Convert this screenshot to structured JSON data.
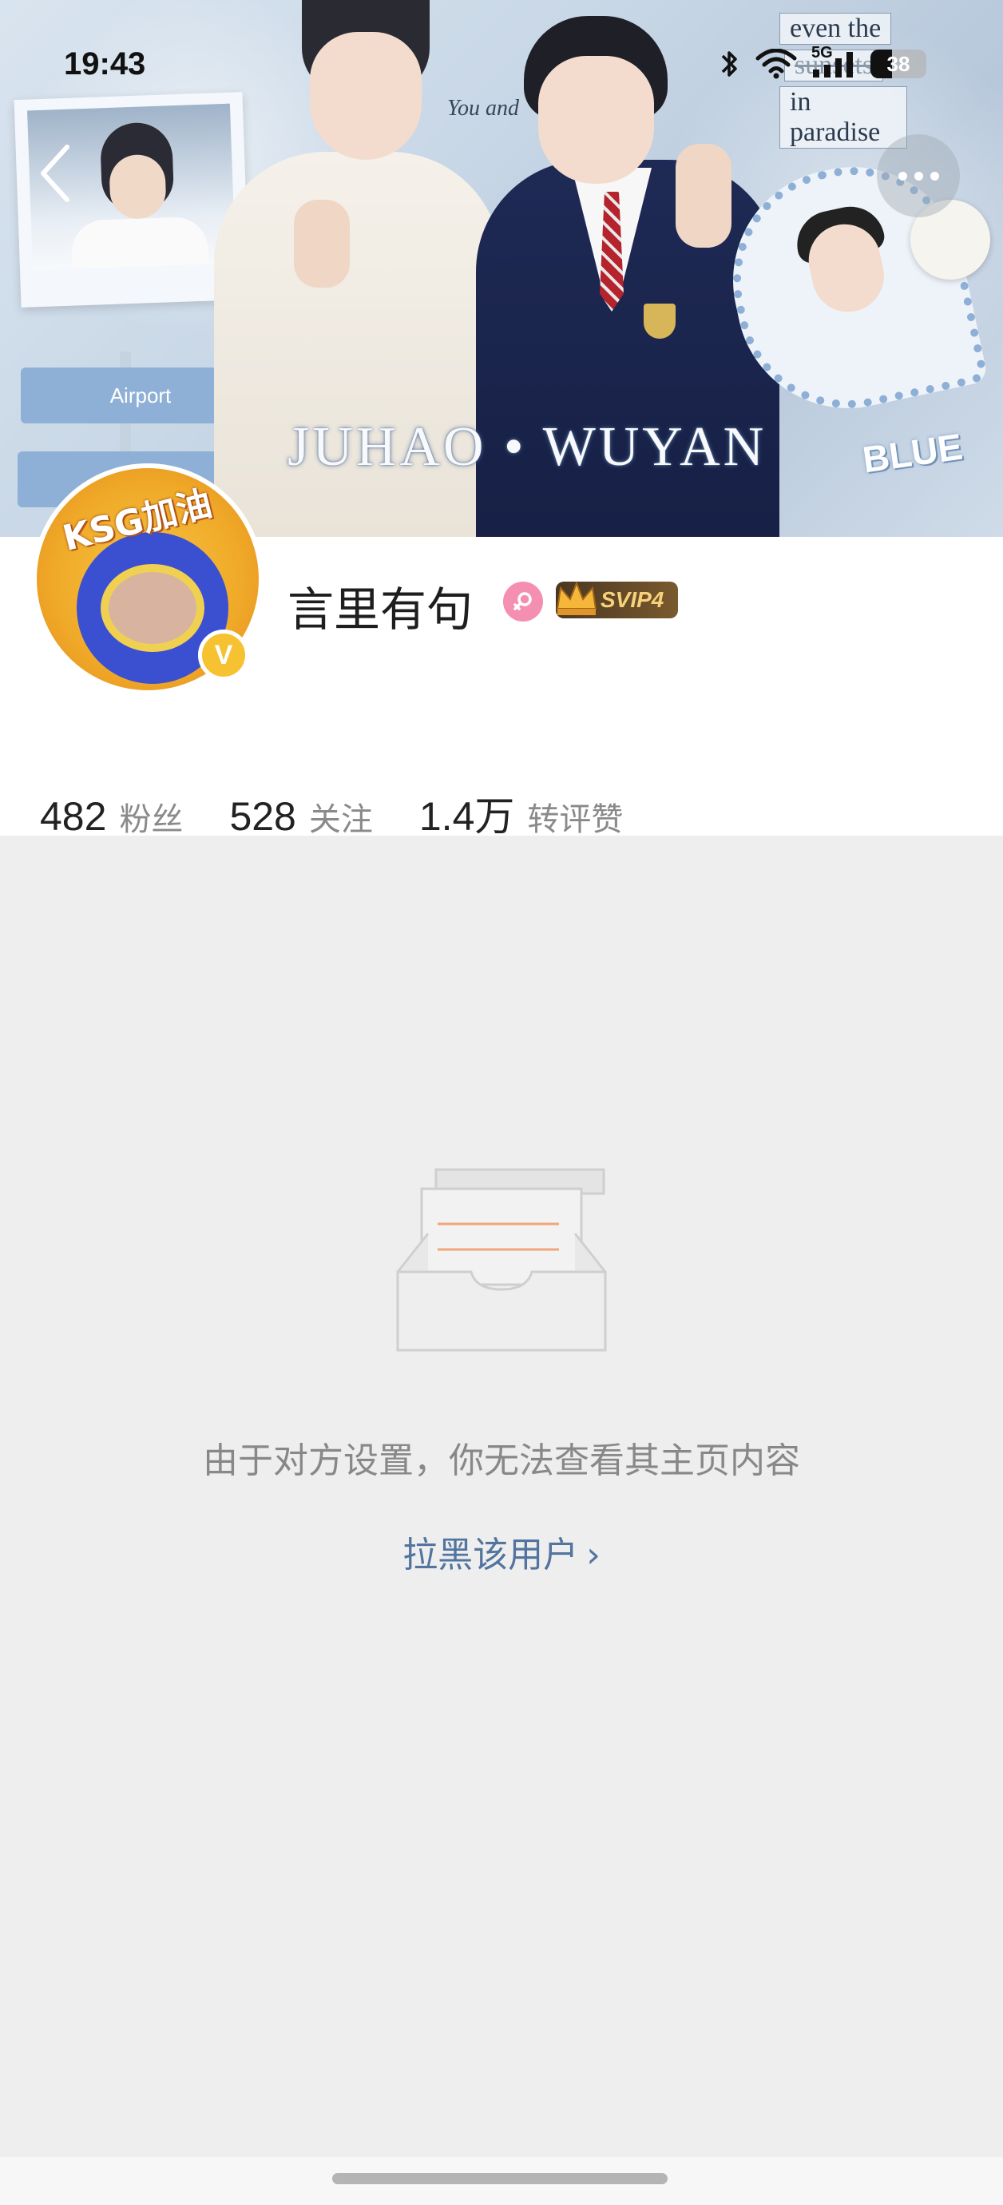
{
  "status_bar": {
    "time": "19:43",
    "network": "5G",
    "battery": "38",
    "battery_level": 0.38
  },
  "banner": {
    "overlay_text": "JUHAO • WUYAN",
    "sticker_lines": [
      "even the",
      "sunsets",
      "in paradise"
    ],
    "you_and": "You and",
    "blue_sticker": "BLUE",
    "airport_sign": "Airport",
    "avatar_text": "KSG加油"
  },
  "nav": {
    "back_icon": "chevron-left-icon",
    "more_icon": "more-dots-icon"
  },
  "profile": {
    "username": "言里有句",
    "gender_icon": "female-icon",
    "vip_label": "SVIP4",
    "verified_icon": "v-badge-icon",
    "stats": [
      {
        "value": "482",
        "label": "粉丝"
      },
      {
        "value": "528",
        "label": "关注"
      },
      {
        "value": "1.4万",
        "label": "转评赞"
      }
    ]
  },
  "empty_state": {
    "icon": "empty-inbox-icon",
    "message": "由于对方设置，你无法查看其主页内容",
    "action_label": "拉黑该用户"
  },
  "colors": {
    "accent_link": "#52749e",
    "background": "#eeeeee",
    "vip_gold": "#f7d27a",
    "gender_pink": "#f48fb1",
    "empty_icon_line": "#f0a57a"
  }
}
